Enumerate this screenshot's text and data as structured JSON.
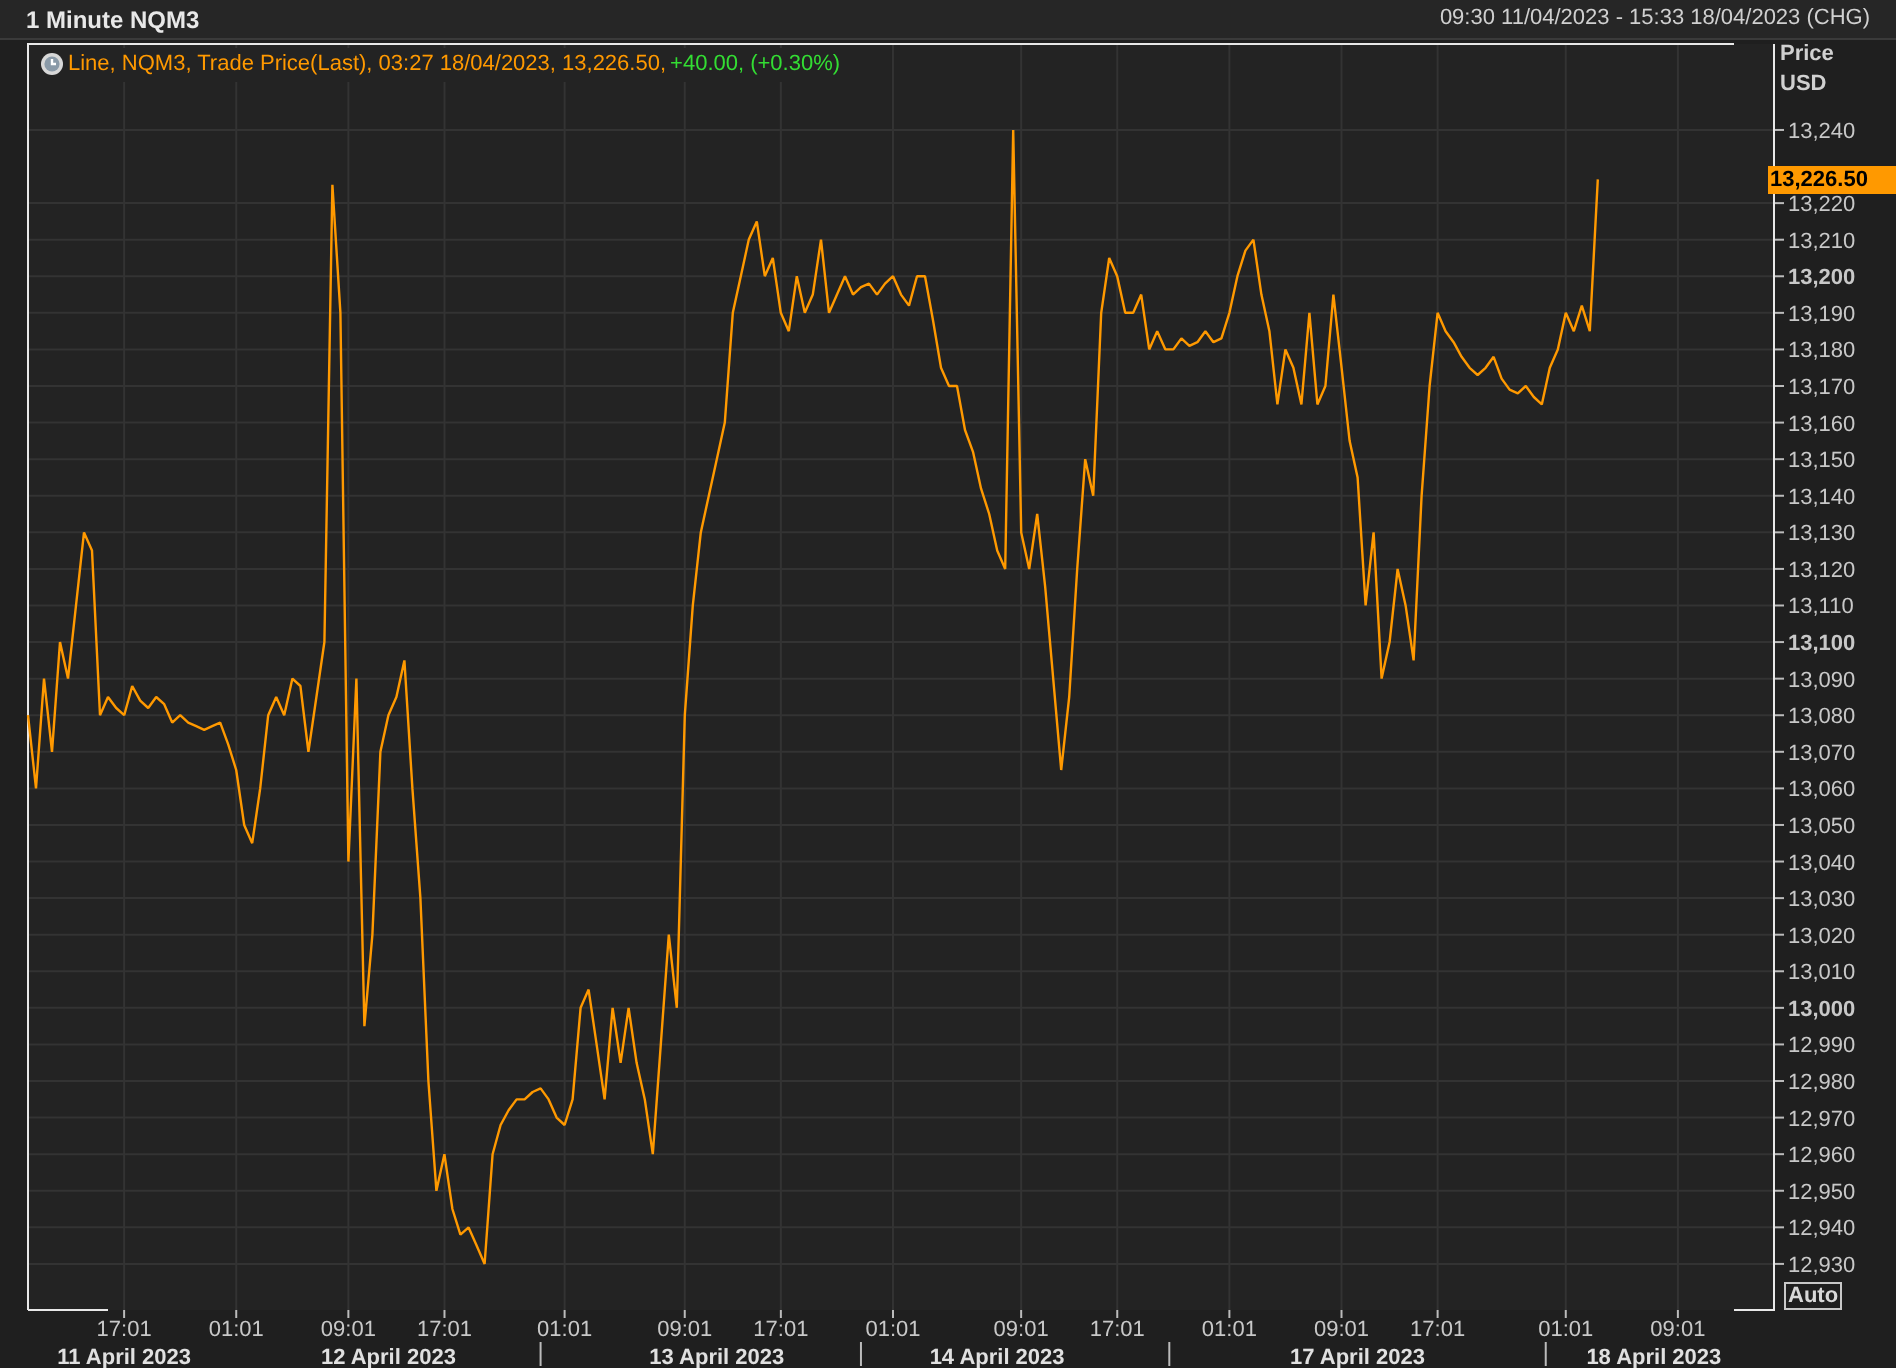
{
  "header": {
    "title": "1 Minute NQM3",
    "range": "09:30 11/04/2023 - 15:33 18/04/2023 (CHG)"
  },
  "chart": {
    "legend": {
      "text": "Line, NQM3, Trade Price(Last), 03:27 18/04/2023, 13,226.50,",
      "change": "+40.00, (+0.30%)"
    },
    "last_price": {
      "label": "13,226.50"
    },
    "yunit": "USD",
    "auto_button": "Auto",
    "date_ticks": [
      "11 April 2023",
      "12 April 2023",
      "13 April 2023",
      "14 April 2023",
      "17 April 2023",
      "18 April 2023"
    ],
    "chart_data": {
      "type": "line",
      "grid": true,
      "ylabel": "Price",
      "ylim": [
        12917.4,
        13263.5
      ],
      "categories": [
        null,
        null,
        null,
        null,
        null,
        null,
        null,
        null,
        null,
        null,
        null,
        null,
        "17:01",
        null,
        null,
        null,
        null,
        null,
        null,
        null,
        null,
        null,
        null,
        null,
        null,
        null,
        "01:01",
        null,
        null,
        null,
        null,
        null,
        null,
        null,
        null,
        null,
        null,
        null,
        null,
        null,
        "09:01",
        null,
        null,
        null,
        null,
        null,
        null,
        null,
        null,
        null,
        null,
        null,
        "17:01",
        null,
        null,
        null,
        null,
        null,
        null,
        null,
        null,
        null,
        null,
        null,
        null,
        null,
        null,
        "01:01",
        null,
        null,
        null,
        null,
        null,
        null,
        null,
        null,
        null,
        null,
        null,
        null,
        null,
        null,
        "09:01",
        null,
        null,
        null,
        null,
        null,
        null,
        null,
        null,
        null,
        null,
        null,
        "17:01",
        null,
        null,
        null,
        null,
        null,
        null,
        null,
        null,
        null,
        null,
        null,
        null,
        null,
        "01:01",
        null,
        null,
        null,
        null,
        null,
        null,
        null,
        null,
        null,
        null,
        null,
        null,
        null,
        null,
        null,
        "09:01",
        null,
        null,
        null,
        null,
        null,
        null,
        null,
        null,
        null,
        null,
        null,
        "17:01",
        null,
        null,
        null,
        null,
        null,
        null,
        null,
        null,
        null,
        null,
        null,
        null,
        null,
        "01:01",
        null,
        null,
        null,
        null,
        null,
        null,
        null,
        null,
        null,
        null,
        null,
        null,
        null,
        "09:01",
        null,
        null,
        null,
        null,
        null,
        null,
        null,
        null,
        null,
        null,
        null,
        "17:01",
        null,
        null,
        null,
        null,
        null,
        null,
        null,
        null,
        null,
        null,
        null,
        null,
        null,
        null,
        null,
        "01:01",
        null,
        null,
        null,
        null,
        null,
        null,
        null,
        null,
        null,
        null,
        null,
        null,
        null,
        "09:01",
        null,
        null,
        null,
        null,
        null,
        null,
        null,
        null,
        null,
        null,
        null,
        null
      ],
      "yticks": [
        {
          "value": 13240,
          "label": "13,240"
        },
        {
          "value": 13220,
          "label": "13,220"
        },
        {
          "value": 13210,
          "label": "13,210"
        },
        {
          "value": 13200,
          "label": "13,200"
        },
        {
          "value": 13190,
          "label": "13,190"
        },
        {
          "value": 13180,
          "label": "13,180"
        },
        {
          "value": 13170,
          "label": "13,170"
        },
        {
          "value": 13160,
          "label": "13,160"
        },
        {
          "value": 13150,
          "label": "13,150"
        },
        {
          "value": 13140,
          "label": "13,140"
        },
        {
          "value": 13130,
          "label": "13,130"
        },
        {
          "value": 13120,
          "label": "13,120"
        },
        {
          "value": 13110,
          "label": "13,110"
        },
        {
          "value": 13100,
          "label": "13,100"
        },
        {
          "value": 13090,
          "label": "13,090"
        },
        {
          "value": 13080,
          "label": "13,080"
        },
        {
          "value": 13070,
          "label": "13,070"
        },
        {
          "value": 13060,
          "label": "13,060"
        },
        {
          "value": 13050,
          "label": "13,050"
        },
        {
          "value": 13040,
          "label": "13,040"
        },
        {
          "value": 13030,
          "label": "13,030"
        },
        {
          "value": 13020,
          "label": "13,020"
        },
        {
          "value": 13010,
          "label": "13,010"
        },
        {
          "value": 13000,
          "label": "13,000"
        },
        {
          "value": 12990,
          "label": "12,990"
        },
        {
          "value": 12980,
          "label": "12,980"
        },
        {
          "value": 12970,
          "label": "12,970"
        },
        {
          "value": 12960,
          "label": "12,960"
        },
        {
          "value": 12950,
          "label": "12,950"
        },
        {
          "value": 12940,
          "label": "12,940"
        },
        {
          "value": 12930,
          "label": "12,930"
        }
      ],
      "series": [
        {
          "color": "#ff9900",
          "values": [
            13080,
            13060,
            13090,
            13070,
            13100,
            13090,
            13110,
            13130,
            13125,
            13080,
            13085,
            13082,
            13080,
            13088,
            13084,
            13082,
            13085,
            13083,
            13078,
            13080,
            13078,
            13077,
            13076,
            13077,
            13078,
            13072,
            13065,
            13050,
            13045,
            13060,
            13080,
            13085,
            13080,
            13090,
            13088,
            13070,
            13085,
            13100,
            13225,
            13190,
            13040,
            13090,
            12995,
            13020,
            13070,
            13080,
            13085,
            13095,
            13060,
            13030,
            12980,
            12950,
            12960,
            12945,
            12938,
            12940,
            12935,
            12930,
            12960,
            12968,
            12972,
            12975,
            12975,
            12977,
            12978,
            12975,
            12970,
            12968,
            12975,
            13000,
            13005,
            12990,
            12975,
            13000,
            12985,
            13000,
            12985,
            12975,
            12960,
            12990,
            13020,
            13000,
            13080,
            13110,
            13130,
            13140,
            13150,
            13160,
            13190,
            13200,
            13210,
            13215,
            13200,
            13205,
            13190,
            13185,
            13200,
            13190,
            13195,
            13210,
            13190,
            13195,
            13200,
            13195,
            13197,
            13198,
            13195,
            13198,
            13200,
            13195,
            13192,
            13200,
            13200,
            13188,
            13175,
            13170,
            13170,
            13158,
            13152,
            13142,
            13135,
            13125,
            13120,
            13240,
            13130,
            13120,
            13135,
            13115,
            13090,
            13065,
            13085,
            13120,
            13150,
            13140,
            13190,
            13205,
            13200,
            13190,
            13190,
            13195,
            13180,
            13185,
            13180,
            13180,
            13183,
            13181,
            13182,
            13185,
            13182,
            13183,
            13190,
            13200,
            13207,
            13210,
            13195,
            13185,
            13165,
            13180,
            13175,
            13165,
            13190,
            13165,
            13170,
            13195,
            13175,
            13155,
            13145,
            13110,
            13130,
            13090,
            13100,
            13120,
            13110,
            13095,
            13140,
            13170,
            13190,
            13185,
            13182,
            13178,
            13175,
            13173,
            13175,
            13178,
            13172,
            13169,
            13168,
            13170,
            13167,
            13165,
            13175,
            13180,
            13190,
            13185,
            13192,
            13185,
            13226.5,
            null,
            null,
            null,
            null,
            null,
            null,
            null,
            null,
            null,
            null,
            null,
            null,
            null,
            null,
            null,
            null,
            null,
            null,
            null,
            null,
            null,
            null
          ]
        }
      ]
    }
  }
}
